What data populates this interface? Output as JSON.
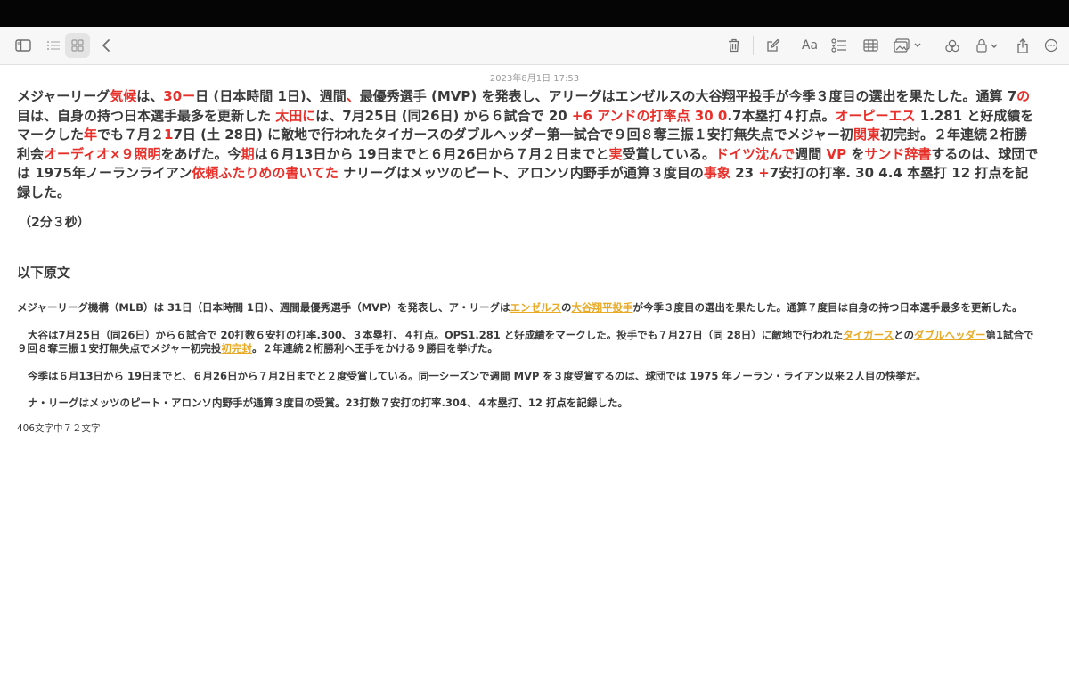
{
  "toolbar": {
    "left": [
      "sidebar-icon",
      "list-view-icon",
      "gallery-view-icon",
      "back-icon"
    ],
    "right": [
      "trash-icon",
      "compose-icon",
      "text-format-icon",
      "checklist-icon",
      "table-icon",
      "media-icon",
      "collaborate-icon",
      "lock-icon",
      "share-icon",
      "more-icon"
    ],
    "format_label": "Aa"
  },
  "note": {
    "timestamp": "2023年8月1日 17:53",
    "lead": [
      {
        "t": "メジャーリーグ"
      },
      {
        "t": "気候",
        "r": true
      },
      {
        "t": "は、"
      },
      {
        "t": "30ー",
        "r": true
      },
      {
        "t": "日 (日本時間 1日)、週間"
      },
      {
        "t": "、",
        "r": true
      },
      {
        "t": "最優秀選手 (MVP) を発表し、アリーグはエンゼルスの大谷翔平投手が今季３度目の選出を果たした。通算 7"
      },
      {
        "t": "の",
        "r": true
      },
      {
        "t": "目は、自身の持つ日本選手最多を更新した "
      },
      {
        "t": "太田に",
        "r": true
      },
      {
        "t": "は、7月25日 (同26日) から６試合で 20 "
      },
      {
        "t": "+6 アンドの打率点 30 0",
        "r": true
      },
      {
        "t": ".7本塁打４打点。"
      },
      {
        "t": "オーピーエス",
        "r": true
      },
      {
        "t": " 1.281 と好成績をマークした"
      },
      {
        "t": "年",
        "r": true
      },
      {
        "t": "でも７月２"
      },
      {
        "t": "1",
        "r": true
      },
      {
        "t": "7日 (土 28日) に敵地で行われたタイガースのダブルヘッダー第一試合で９回８奪三振１安打無失点でメジャー初"
      },
      {
        "t": "関東",
        "r": true
      },
      {
        "t": "初完封。２年連続２桁勝利会"
      },
      {
        "t": "オーディオ×９照明",
        "r": true
      },
      {
        "t": "をあげた。今"
      },
      {
        "t": "期",
        "r": true
      },
      {
        "t": "は６月13日から 19日までと６月26日から７月２日までと"
      },
      {
        "t": "実",
        "r": true
      },
      {
        "t": "受賞している。"
      },
      {
        "t": "ドイツ沈んで",
        "r": true
      },
      {
        "t": "週間 "
      },
      {
        "t": "VP",
        "r": true
      },
      {
        "t": " を"
      },
      {
        "t": "サンド辞書",
        "r": true
      },
      {
        "t": "するのは、球団では 1975年ノーランライアン"
      },
      {
        "t": "依頼ふたりめの書いてた",
        "r": true
      },
      {
        "t": " ナリーグはメッツのピート、アロンソ内野手が通算３度目の"
      },
      {
        "t": "事象",
        "r": true
      },
      {
        "t": " 23 "
      },
      {
        "t": "+",
        "r": true
      },
      {
        "t": "7安打の打率. 30 4.4 本塁打 12 打点を記録した。"
      }
    ],
    "duration": "（2分３秒）",
    "original_heading": "以下原文",
    "original": [
      [
        {
          "t": "メジャーリーグ機構（MLB）は 31日（日本時間 1日）、週間最優秀選手（MVP）を発表し、ア・リーグは"
        },
        {
          "t": "エンゼルス",
          "u": true
        },
        {
          "t": "の"
        },
        {
          "t": "大谷翔平投手",
          "u": true
        },
        {
          "t": "が今季３度目の選出を果たした。通算７度目は自身の持つ日本選手最多を更新した。"
        }
      ],
      [
        {
          "t": "大谷は7月25日（同26日）から６試合で 20打数６安打の打率.300、３本塁打、４打点。OPS1.281 と好成績をマークした。投手でも７月27日（同 28日）に敵地で行われた"
        },
        {
          "t": "タイガース",
          "u": true
        },
        {
          "t": "との"
        },
        {
          "t": "ダブルヘッダー",
          "u": true
        },
        {
          "t": "第1試合で９回８奪三振１安打無失点でメジャー初完投"
        },
        {
          "t": "初完封",
          "u": true
        },
        {
          "t": "。２年連続２桁勝利へ王手をかける９勝目を挙げた。"
        }
      ],
      [
        {
          "t": "今季は６月13日から 19日までと、６月26日から７月2日までと２度受賞している。同一シーズンで週間 MVP を３度受賞するのは、球団では 1975 年ノーラン・ライアン以来２人目の快挙だ。"
        }
      ],
      [
        {
          "t": "ナ・リーグはメッツのピート・アロンソ内野手が通算３度目の受賞。23打数７安打の打率.304、４本塁打、12 打点を記録した。"
        }
      ]
    ],
    "char_count": "406文字中７２文字"
  }
}
